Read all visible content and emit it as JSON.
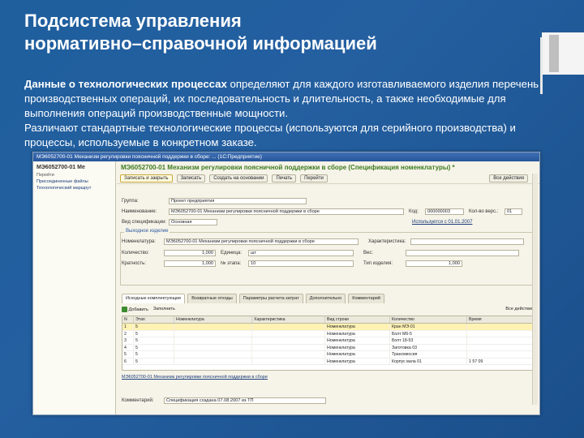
{
  "slide": {
    "title_line1": "Подсистема управления",
    "title_line2": "нормативно–справочной информацией",
    "body_bold": "Данные о технологических процессах",
    "body_rest": " определяют для каждого изготавливаемого изделия перечень производственных операций, их последовательность и длительность, а также необходимые для выполнения операций производственные мощности.",
    "body_line2": "Различают стандартные технологические процессы (используются для серийного производства) и процессы, используемые в конкретном заказе."
  },
  "window": {
    "title": "МЭ6052700-01 Механизм регулировки поясничной поддержки в сборе: ... (1С:Предприятие)",
    "left": {
      "header": "МЭ6052700-01 Ме",
      "links": [
        "Перейти",
        "Присоединенные файлы",
        "Технологический маршрут"
      ]
    },
    "doc_title": "МЭ6052700-01 Механизм регулировки поясничной поддержки в сборе (Спецификация номенклатуры) *",
    "toolbar": {
      "save_close": "Записать и закрыть",
      "write": "Записать",
      "create_basis": "Создать на основании",
      "print": "Печать",
      "goto": "Перейти",
      "all_actions": "Все действия"
    },
    "form": {
      "group_label": "Группа:",
      "group_value": "Проект предприятия",
      "name_label": "Наименование:",
      "name_value": "МЭ6052700-01 Механизм регулировки поясничной поддержки в сборе",
      "code_label": "Код:",
      "code_value": "000000003",
      "version_label": "Кол-во верс.:",
      "version_value": "01",
      "status_label": "Вид спецификации:",
      "status_value": "Основная",
      "status_link": "Используется с 01.01.2007",
      "product_group": "Выходное изделие",
      "nomenclature_label": "Номенклатура:",
      "nomenclature_value": "МЭ6052700-01 Механизм регулировки поясничной поддержки в сборе",
      "characteristic_label": "Характеристика:",
      "qty_label": "Количество:",
      "qty_value": "1,000",
      "unit_label": "Единица:",
      "unit_value": "шт",
      "weight_label": "Вес:",
      "multiplicity_label": "Кратность:",
      "multiplicity_value": "1,000",
      "stage_label": "№ этапа:",
      "stage_value": "10",
      "product_type_label": "Тип изделия:",
      "product_type_value": "1,000"
    },
    "tabs": [
      "Исходные комплектующие",
      "Возвратные отходы",
      "Параметры расчета затрат",
      "Дополнительно",
      "Комментарий"
    ],
    "sub_toolbar": {
      "add": "Добавить",
      "fill": "Заполнить",
      "all_actions": "Все действия"
    },
    "grid": {
      "headers": [
        "N",
        "Этап",
        "Номенклатура",
        "Характеристика",
        "Вид строки",
        "Количество",
        "Время"
      ],
      "rows": [
        {
          "n": "1",
          "stage": "5",
          "nom": "",
          "char": "",
          "kind": "Номенклатура",
          "qty": "Кран МЭ-01",
          "time": ""
        },
        {
          "n": "2",
          "stage": "5",
          "nom": "",
          "char": "",
          "kind": "Номенклатура",
          "qty": "Болт M6-5",
          "time": ""
        },
        {
          "n": "3",
          "stage": "5",
          "nom": "",
          "char": "",
          "kind": "Номенклатура",
          "qty": "Болт 18-53",
          "time": ""
        },
        {
          "n": "4",
          "stage": "5",
          "nom": "",
          "char": "",
          "kind": "Номенклатура",
          "qty": "Заготовка 03",
          "time": ""
        },
        {
          "n": "5",
          "stage": "5",
          "nom": "",
          "char": "",
          "kind": "Номенклатура",
          "qty": "Трансмиссия",
          "time": ""
        },
        {
          "n": "6",
          "stage": "5",
          "nom": "",
          "char": "",
          "kind": "Номенклатура",
          "qty": "Корпус вала 01",
          "time": "1 57 09"
        }
      ]
    },
    "bottom_link": "МЭ6052700-01 Механизм регулировки поясничной поддержки в сборе",
    "comment_label": "Комментарий:",
    "comment_value": "Спецификация создана 07.08.2007 из ТП"
  }
}
